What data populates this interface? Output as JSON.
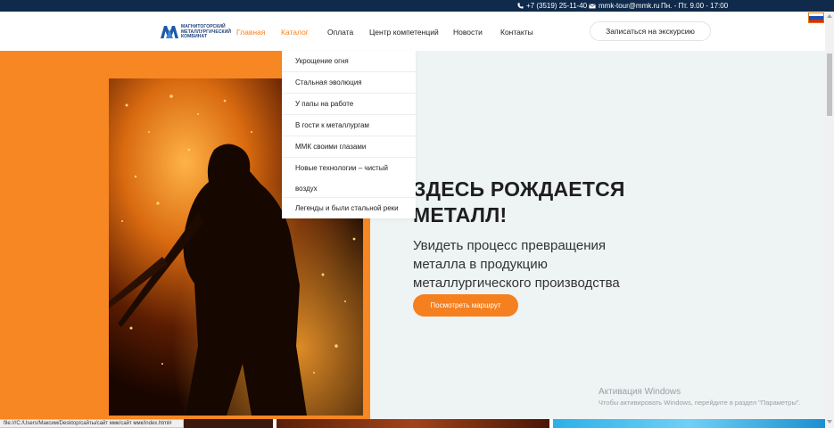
{
  "topbar": {
    "phone": "+7 (3519) 25-11-40",
    "email": "mmk-tour@mmk.ru",
    "hours": "Пн. - Пт. 9.00 - 17:00",
    "phone_icon": "phone-icon",
    "email_icon": "envelope-icon"
  },
  "logo": {
    "line1": "МАГНИТОГОРСКИЙ",
    "line2": "МЕТАЛЛУРГИЧЕСКИЙ",
    "line3": "КОМБИНАТ"
  },
  "nav": {
    "items": [
      "Главная",
      "Каталог",
      "Оплата",
      "Центр компетенций",
      "Новости",
      "Контакты"
    ],
    "active_color": "#f5801f"
  },
  "header_cta": "Записаться на экскурсию",
  "dropdown": {
    "items": [
      "Укрощение огня",
      "Стальная эволюция",
      "У папы на работе",
      "В гости к металлургам",
      "ММК своими глазами",
      "Новые технологии – чистый воздух",
      "Легенды и были стальной реки"
    ]
  },
  "hero": {
    "headline_line1": "ЗДЕСЬ РОЖДАЕТСЯ",
    "headline_line2": "МЕТАЛЛ!",
    "subline": "Увидеть процесс превращения металла в продукцию металлургического производства",
    "button": "Посмотреть маршрут",
    "accent_color": "#f5801f"
  },
  "windows_activation": {
    "title": "Активация Windows",
    "subtitle": "Чтобы активировать Windows, перейдите в раздел \"Параметры\"."
  },
  "statusbar": {
    "url": "file:///C:/Users/Максим/Desktop/сайты/сайт ммк/сайт ммк/index.html#"
  }
}
